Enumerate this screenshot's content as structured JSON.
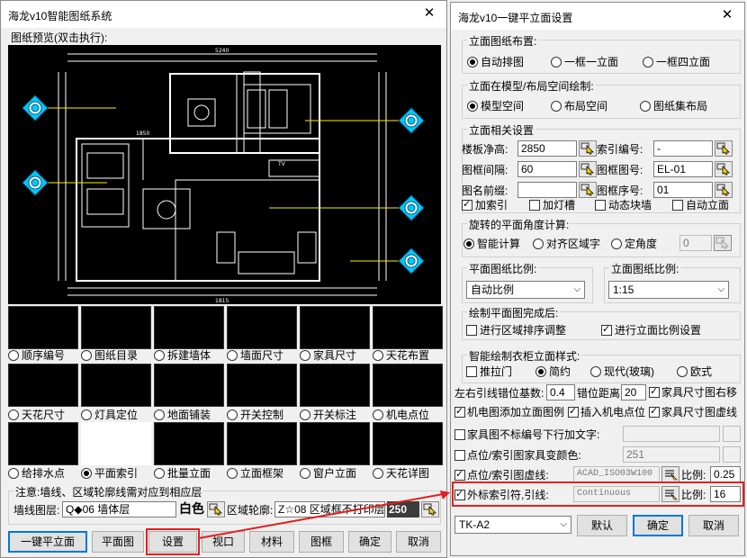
{
  "left_window": {
    "title": "海龙v10智能图纸系统",
    "preview_label": "图纸预览(双击执行):",
    "drawing_text": {
      "dim1": "5240",
      "dim2": "1815",
      "dim3": "1850",
      "room": "TV"
    },
    "options_row1": [
      {
        "label": "顺序编号",
        "selected": false
      },
      {
        "label": "图纸目录",
        "selected": false
      },
      {
        "label": "拆建墙体",
        "selected": false
      },
      {
        "label": "墙面尺寸",
        "selected": false
      },
      {
        "label": "家具尺寸",
        "selected": false
      },
      {
        "label": "天花布置",
        "selected": false
      }
    ],
    "options_row2": [
      {
        "label": "天花尺寸",
        "selected": false
      },
      {
        "label": "灯具定位",
        "selected": false
      },
      {
        "label": "地面铺装",
        "selected": false
      },
      {
        "label": "开关控制",
        "selected": false
      },
      {
        "label": "开关标注",
        "selected": false
      },
      {
        "label": "机电点位",
        "selected": false
      }
    ],
    "options_row3": [
      {
        "label": "给排水点",
        "selected": false
      },
      {
        "label": "平面索引",
        "selected": true
      },
      {
        "label": "批量立面",
        "selected": false
      },
      {
        "label": "立面框架",
        "selected": false
      },
      {
        "label": "窗户立面",
        "selected": false
      },
      {
        "label": "天花详图",
        "selected": false
      }
    ],
    "note_title": "注意:墙线、区域轮廓线需对应到相应层",
    "wall_layer_label": "墙线图层:",
    "wall_layer_value": "Q◆06 墙体层",
    "wall_color": "白色",
    "area_outline_label": "区域轮廓:",
    "area_outline_value": "Z☆08 区域框不打印层",
    "area_color_value": "250",
    "buttons": [
      "一键平立面",
      "平面图",
      "设置",
      "视口",
      "材料",
      "图框",
      "确定",
      "取消"
    ]
  },
  "right_window": {
    "title": "海龙v10一键平立面设置",
    "layout_section": {
      "title": "立面图纸布置:",
      "options": [
        {
          "label": "自动排图",
          "selected": true
        },
        {
          "label": "一框一立面",
          "selected": false
        },
        {
          "label": "一框四立面",
          "selected": false
        }
      ]
    },
    "space_section": {
      "title": "立面在模型/布局空间绘制:",
      "options": [
        {
          "label": "模型空间",
          "selected": true
        },
        {
          "label": "布局空间",
          "selected": false
        },
        {
          "label": "图纸集布局",
          "selected": false
        }
      ]
    },
    "settings_section": {
      "title": "立面相关设置",
      "floor_height_label": "楼板净高:",
      "floor_height_value": "2850",
      "index_no_label": "索引编号:",
      "index_no_value": "-",
      "frame_gap_label": "图框间隔:",
      "frame_gap_value": "60",
      "frame_no_label": "图框图号:",
      "frame_no_value": "EL-01",
      "name_prefix_label": "图名前缀:",
      "name_prefix_value": "",
      "frame_seq_label": "图框序号:",
      "frame_seq_value": "01",
      "checks": [
        {
          "label": "加索引",
          "checked": true
        },
        {
          "label": "加灯槽",
          "checked": false
        },
        {
          "label": "动态块墙",
          "checked": false
        },
        {
          "label": "自动立面",
          "checked": false
        }
      ]
    },
    "rotation_section": {
      "title": "旋转的平面角度计算:",
      "options": [
        {
          "label": "智能计算",
          "selected": true
        },
        {
          "label": "对齐区域字",
          "selected": false
        },
        {
          "label": "定角度",
          "selected": false
        }
      ],
      "angle_value": "0"
    },
    "plan_scale_section": {
      "title": "平面图纸比例:",
      "value": "自动比例"
    },
    "elev_scale_section": {
      "title": "立面图纸比例:",
      "value": "1:15"
    },
    "after_plan_section": {
      "title": "绘制平面图完成后:",
      "checks": [
        {
          "label": "进行区域排序调整",
          "checked": false
        },
        {
          "label": "进行立面比例设置",
          "checked": true
        }
      ]
    },
    "style_section": {
      "title": "智能绘制衣柜立面样式:",
      "push_door_label": "推拉门",
      "push_door_checked": false,
      "options": [
        {
          "label": "简约",
          "selected": true
        },
        {
          "label": "现代(玻璃)",
          "selected": false
        },
        {
          "label": "欧式",
          "selected": false
        }
      ]
    },
    "leader_offset_label": "左右引线错位基数:",
    "leader_offset_value": "0.4",
    "offset_distance_label": "错位距离",
    "offset_distance_value": "20",
    "furniture_dim_right": {
      "label": "家具尺寸图右移",
      "checked": true
    },
    "mep_legend": {
      "label": "机电图添加立面图例",
      "checked": true
    },
    "insert_mep": {
      "label": "插入机电点位",
      "checked": true
    },
    "furniture_dim_dashed": {
      "label": "家具尺寸图虚线",
      "checked": true
    },
    "furniture_no_text": {
      "label": "家具图不标编号下行加文字:",
      "checked": false,
      "value": ""
    },
    "point_color": {
      "label": "点位/索引图家具变颜色:",
      "checked": false,
      "value": "251"
    },
    "point_dashed": {
      "label": "点位/索引图虚线:",
      "checked": true,
      "linetype": "ACAD_ISO03W100",
      "scale_label": "比例:",
      "scale_value": "0.25"
    },
    "outer_index": {
      "label": "外标索引符,引线:",
      "checked": true,
      "linetype": "Continuous",
      "scale_label": "比例:",
      "scale_value": "16"
    },
    "frame_select_value": "TK-A2",
    "buttons": [
      "默认",
      "确定",
      "取消"
    ]
  },
  "colors": {
    "highlight_red": "#e02020",
    "default_blue": "#0078d7",
    "cad_black": "#000000"
  }
}
